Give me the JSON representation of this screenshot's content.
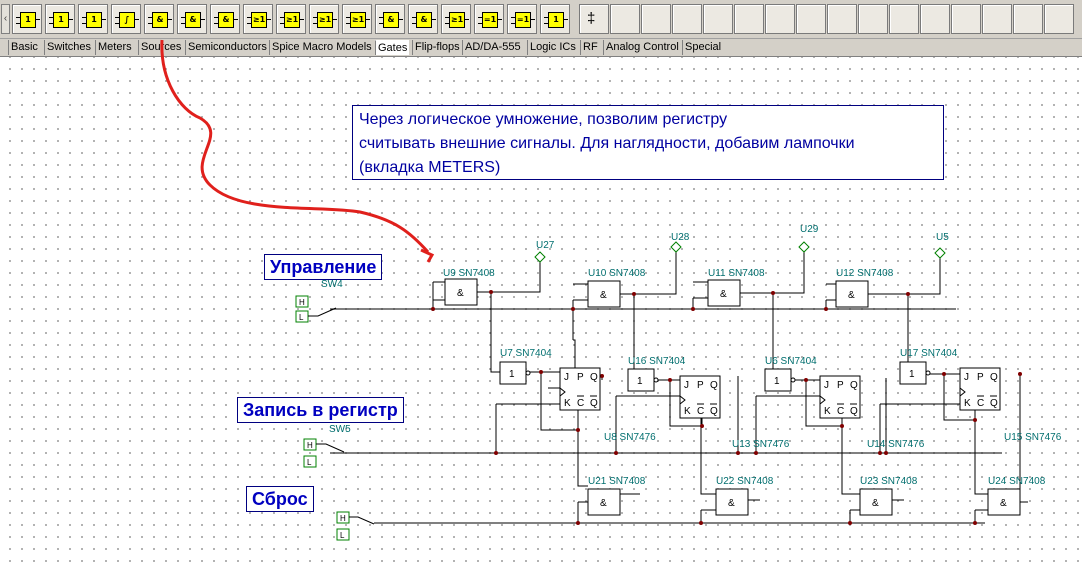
{
  "toolbar": {
    "buttons": [
      {
        "glyph": "1",
        "icon": "buffer-gate-icon"
      },
      {
        "glyph": "1",
        "icon": "inverter-gate-icon"
      },
      {
        "glyph": "1",
        "icon": "tristate-buffer-icon"
      },
      {
        "glyph": "∫",
        "icon": "schmitt-trigger-icon"
      },
      {
        "glyph": "&",
        "icon": "and-gate-icon"
      },
      {
        "glyph": "&",
        "icon": "nand-gate-icon"
      },
      {
        "glyph": "&",
        "icon": "and3-gate-icon"
      },
      {
        "glyph": "≥1",
        "icon": "or-gate-icon"
      },
      {
        "glyph": "≥1",
        "icon": "nor-gate-icon"
      },
      {
        "glyph": "≥1",
        "icon": "or3-gate-icon"
      },
      {
        "glyph": "≥1",
        "icon": "nor3-gate-icon"
      },
      {
        "glyph": "&",
        "icon": "and4-gate-icon"
      },
      {
        "glyph": "&",
        "icon": "nand4-gate-icon"
      },
      {
        "glyph": "≥1",
        "icon": "or4-gate-icon"
      },
      {
        "glyph": "=1",
        "icon": "xor-gate-icon"
      },
      {
        "glyph": "=1",
        "icon": "xnor-gate-icon"
      },
      {
        "glyph": "1",
        "icon": "open-collector-icon"
      }
    ],
    "probe_glyph": "‡"
  },
  "tabs": [
    "Basic",
    "Switches",
    "Meters",
    "Sources",
    "Semiconductors",
    "Spice Macro Models",
    "Gates",
    "Flip-flops",
    "AD/DA-555",
    "Logic ICs",
    "RF",
    "Analog Control",
    "Special"
  ],
  "selected_tab": "Gates",
  "note": {
    "line1": "Через логическое умножение, позволим регистру",
    "line2": "считывать внешние сигналы. Для наглядности, добавим лампочки",
    "line3": "(вкладка METERS)"
  },
  "labels": {
    "control": "Управление",
    "write": "Запись в регистр",
    "reset": "Сброс"
  },
  "switches": {
    "sw4": "SW4",
    "sw5": "SW5",
    "h": "H",
    "l": "L"
  },
  "components": {
    "u9": "U9 SN7408",
    "u10": "U10 SN7408",
    "u11": "U11 SN7408",
    "u12": "U12 SN7408",
    "u7": "U7 SN7404",
    "u16": "U16 SN7404",
    "u6": "U6 SN7404",
    "u17": "U17 SN7404",
    "u8": "U8 SN7476",
    "u13": "U13 SN7476",
    "u14": "U14 SN7476",
    "u15": "U15 SN7476",
    "u21": "U21 SN7408",
    "u22": "U22 SN7408",
    "u23": "U23 SN7408",
    "u24": "U24 SN7408",
    "u27": "U27",
    "u28": "U28",
    "u29": "U29",
    "u5": "U5"
  },
  "gate_symbols": {
    "and": "&",
    "not": "1"
  },
  "ff_pins": {
    "j": "J",
    "p": "P",
    "q": "Q",
    "k": "K",
    "c": "C",
    "qb": "Q"
  },
  "colors": {
    "wire": "#000000",
    "node": "#800000",
    "component_label": "#006e6e",
    "note_text": "#0000a0",
    "label_text": "#0000c0",
    "arrow": "#e0201c",
    "switch": "#008000"
  }
}
